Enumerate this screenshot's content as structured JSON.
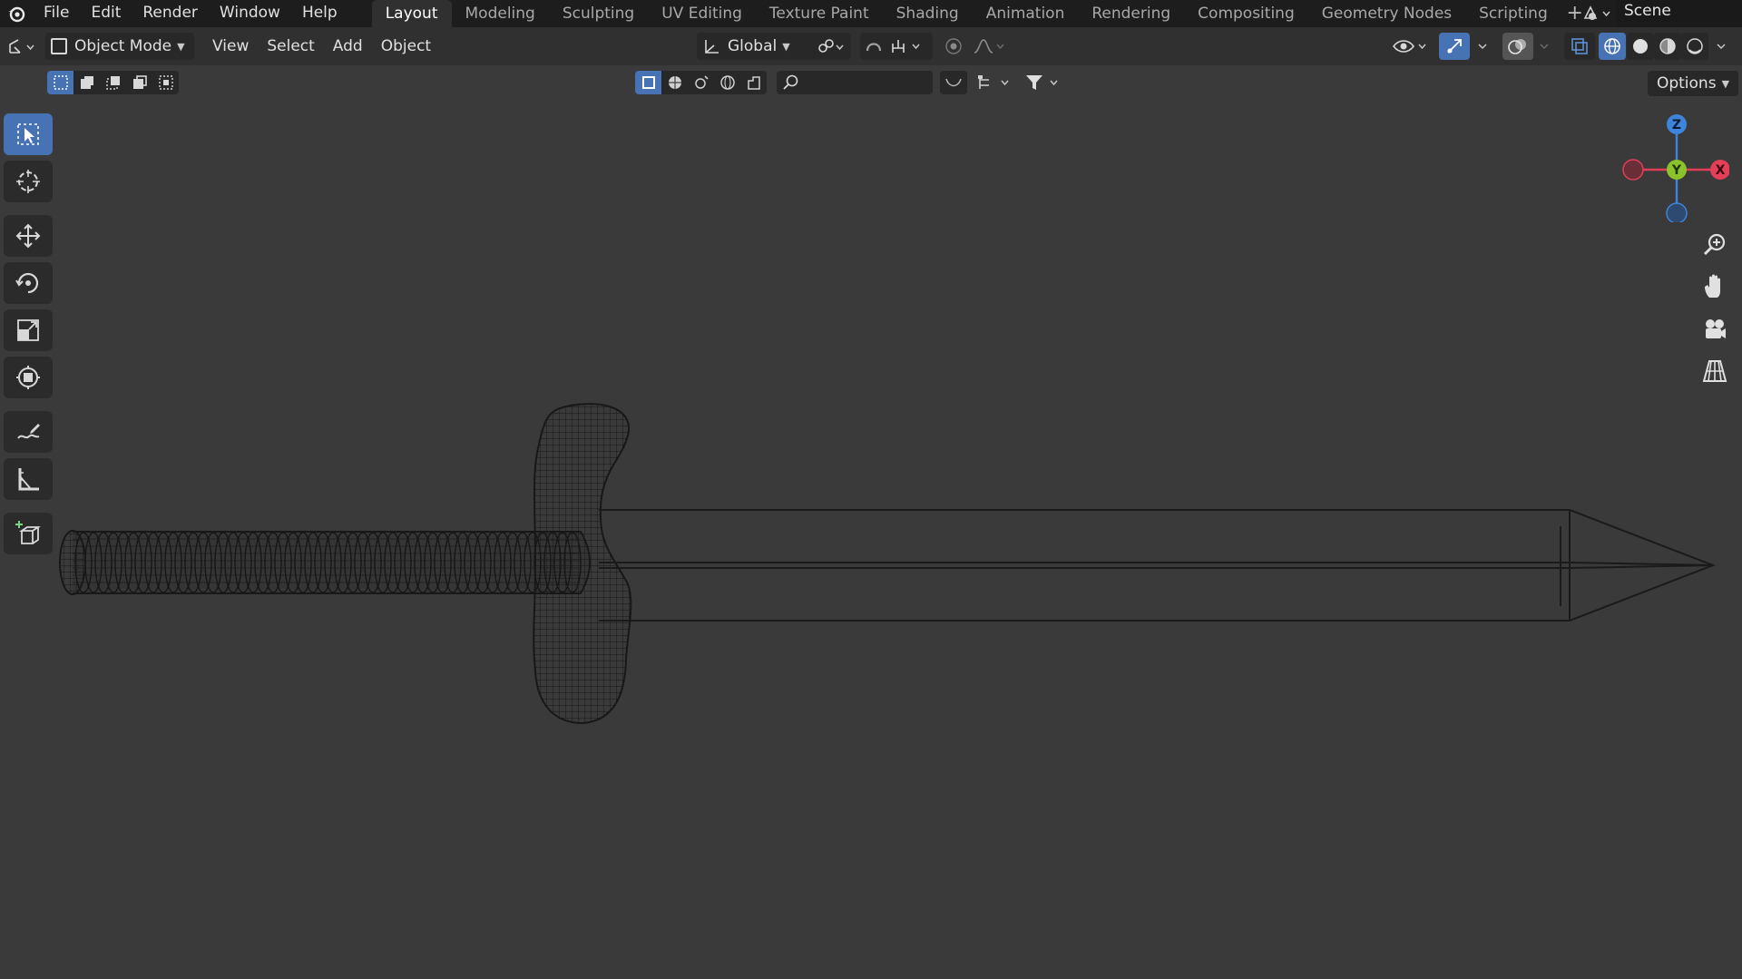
{
  "topbar": {
    "menus": [
      "File",
      "Edit",
      "Render",
      "Window",
      "Help"
    ],
    "workspaces": [
      "Layout",
      "Modeling",
      "Sculpting",
      "UV Editing",
      "Texture Paint",
      "Shading",
      "Animation",
      "Rendering",
      "Compositing",
      "Geometry Nodes",
      "Scripting"
    ],
    "active_workspace": "Layout",
    "add_workspace": "+",
    "scene_name": "Scene"
  },
  "viewport_header": {
    "mode": "Object Mode",
    "menus": [
      "View",
      "Select",
      "Add",
      "Object"
    ],
    "transform_orientation": "Global",
    "options_label": "Options"
  },
  "gizmo": {
    "z": "Z",
    "y": "Y",
    "x": "X"
  },
  "icons": {
    "toolbar": [
      "select-box-icon",
      "cursor-icon",
      "move-icon",
      "rotate-icon",
      "scale-icon",
      "transform-icon",
      "annotate-icon",
      "measure-icon",
      "add-cube-icon"
    ],
    "navigation": [
      "zoom-icon",
      "pan-hand-icon",
      "camera-view-icon",
      "ortho-grid-icon"
    ]
  },
  "colors": {
    "accent": "#4772b3",
    "axis_x": "#e33f58",
    "axis_y": "#8bc42a",
    "axis_z": "#3d84da",
    "viewport_bg": "#3a3a3a"
  }
}
